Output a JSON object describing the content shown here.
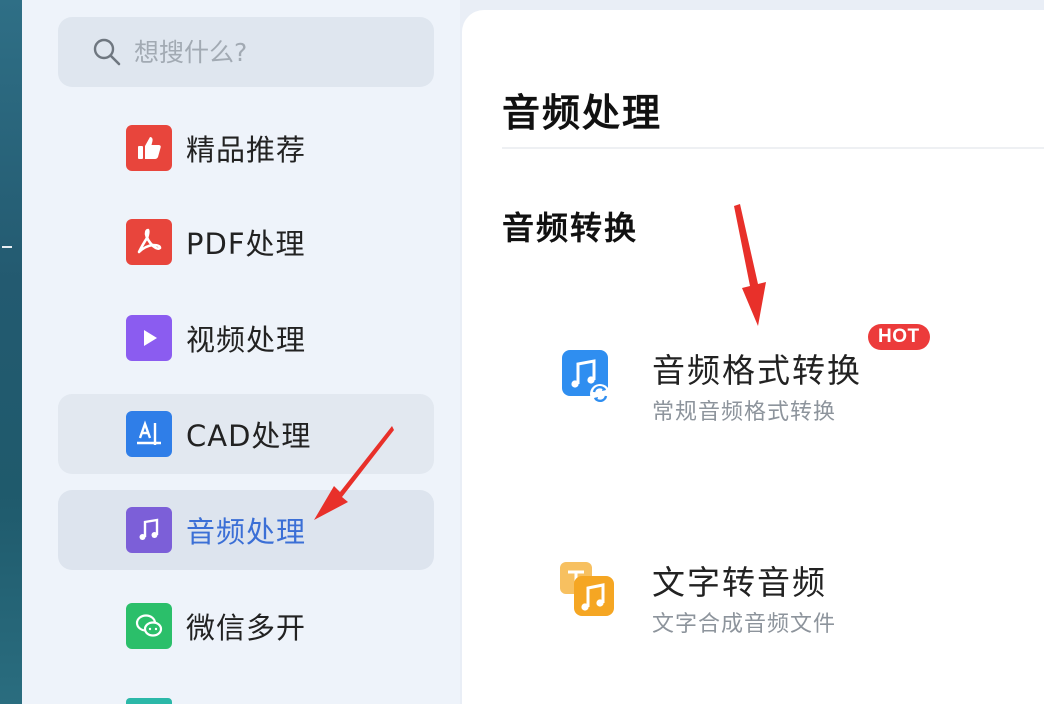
{
  "search": {
    "placeholder": "想搜什么?"
  },
  "sidebar": {
    "items": [
      {
        "label": "精品推荐",
        "icon": "thumbs-up-icon",
        "color": "#e8453c"
      },
      {
        "label": "PDF处理",
        "icon": "pdf-icon",
        "color": "#e8453c"
      },
      {
        "label": "视频处理",
        "icon": "play-icon",
        "color": "#8b5cf0"
      },
      {
        "label": "CAD处理",
        "icon": "cad-icon",
        "color": "#2f7ee8"
      },
      {
        "label": "音频处理",
        "icon": "music-note-icon",
        "color": "#7c5fd8",
        "active": true
      },
      {
        "label": "微信多开",
        "icon": "wechat-icon",
        "color": "#2bbf6a"
      }
    ]
  },
  "main": {
    "title": "音频处理",
    "section": "音频转换",
    "tools": [
      {
        "name": "音频格式转换",
        "desc": "常规音频格式转换",
        "badge": "HOT",
        "icon": "audio-convert-icon",
        "color": "#2f8ef0"
      },
      {
        "name": "文字转音频",
        "desc": "文字合成音频文件",
        "icon": "text-to-audio-icon",
        "color": "#f5a623"
      }
    ]
  },
  "colors": {
    "accent": "#3b6fd6",
    "hot": "#ec3b3b",
    "arrow": "#e8302a"
  }
}
